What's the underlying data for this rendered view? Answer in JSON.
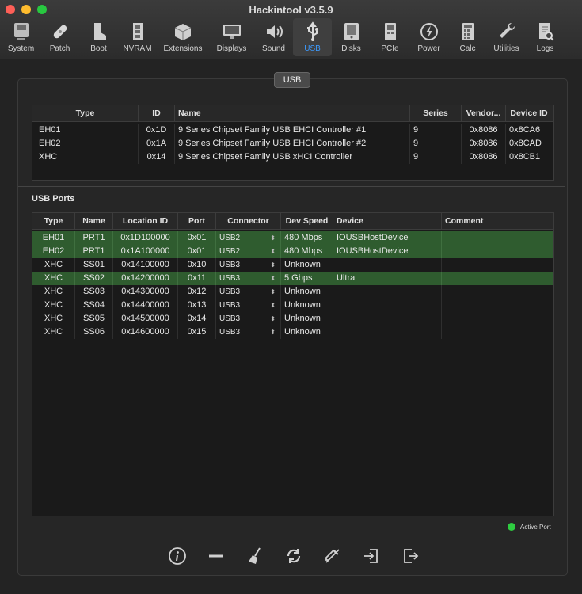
{
  "window": {
    "title": "Hackintool v3.5.9"
  },
  "toolbar": [
    {
      "id": "system",
      "label": "System",
      "icon": "computer-icon"
    },
    {
      "id": "patch",
      "label": "Patch",
      "icon": "bandage-icon"
    },
    {
      "id": "boot",
      "label": "Boot",
      "icon": "boot-icon"
    },
    {
      "id": "nvram",
      "label": "NVRAM",
      "icon": "memory-chip-icon"
    },
    {
      "id": "extensions",
      "label": "Extensions",
      "icon": "package-icon"
    },
    {
      "id": "displays",
      "label": "Displays",
      "icon": "monitor-icon"
    },
    {
      "id": "sound",
      "label": "Sound",
      "icon": "speaker-icon"
    },
    {
      "id": "usb",
      "label": "USB",
      "icon": "usb-icon",
      "active": true
    },
    {
      "id": "disks",
      "label": "Disks",
      "icon": "disk-icon"
    },
    {
      "id": "pcie",
      "label": "PCIe",
      "icon": "pcie-card-icon"
    },
    {
      "id": "power",
      "label": "Power",
      "icon": "lightning-icon"
    },
    {
      "id": "calc",
      "label": "Calc",
      "icon": "calculator-icon"
    },
    {
      "id": "utilities",
      "label": "Utilities",
      "icon": "wrench-icon"
    },
    {
      "id": "logs",
      "label": "Logs",
      "icon": "log-document-icon"
    }
  ],
  "panel": {
    "tab_label": "USB"
  },
  "controllers": {
    "headers": [
      "Type",
      "ID",
      "Name",
      "Series",
      "Vendor...",
      "Device ID"
    ],
    "rows": [
      [
        "EH01",
        "0x1D",
        "9 Series Chipset Family USB EHCI Controller #1",
        "9",
        "0x8086",
        "0x8CA6"
      ],
      [
        "EH02",
        "0x1A",
        "9 Series Chipset Family USB EHCI Controller #2",
        "9",
        "0x8086",
        "0x8CAD"
      ],
      [
        "XHC",
        "0x14",
        "9 Series Chipset Family USB xHCI Controller",
        "9",
        "0x8086",
        "0x8CB1"
      ]
    ]
  },
  "ports": {
    "title": "USB Ports",
    "headers": [
      "Type",
      "Name",
      "Location ID",
      "Port",
      "Connector",
      "Dev Speed",
      "Device",
      "Comment"
    ],
    "rows": [
      {
        "active": true,
        "cells": [
          "EH01",
          "PRT1",
          "0x1D100000",
          "0x01",
          "USB2",
          "480 Mbps",
          "IOUSBHostDevice",
          ""
        ]
      },
      {
        "active": true,
        "cells": [
          "EH02",
          "PRT1",
          "0x1A100000",
          "0x01",
          "USB2",
          "480 Mbps",
          "IOUSBHostDevice",
          ""
        ]
      },
      {
        "active": false,
        "cells": [
          "XHC",
          "SS01",
          "0x14100000",
          "0x10",
          "USB3",
          "Unknown",
          "",
          ""
        ]
      },
      {
        "active": true,
        "cells": [
          "XHC",
          "SS02",
          "0x14200000",
          "0x11",
          "USB3",
          "5 Gbps",
          "Ultra",
          ""
        ]
      },
      {
        "active": false,
        "cells": [
          "XHC",
          "SS03",
          "0x14300000",
          "0x12",
          "USB3",
          "Unknown",
          "",
          ""
        ]
      },
      {
        "active": false,
        "cells": [
          "XHC",
          "SS04",
          "0x14400000",
          "0x13",
          "USB3",
          "Unknown",
          "",
          ""
        ]
      },
      {
        "active": false,
        "cells": [
          "XHC",
          "SS05",
          "0x14500000",
          "0x14",
          "USB3",
          "Unknown",
          "",
          ""
        ]
      },
      {
        "active": false,
        "cells": [
          "XHC",
          "SS06",
          "0x14600000",
          "0x15",
          "USB3",
          "Unknown",
          "",
          ""
        ]
      }
    ]
  },
  "legend": {
    "label": "Active Port",
    "color": "#2ecc40"
  },
  "colors": {
    "active_row": "#2f5c2f",
    "accent": "#3d9bff"
  },
  "actions": [
    {
      "id": "info",
      "icon": "info-icon"
    },
    {
      "id": "remove",
      "icon": "minus-icon"
    },
    {
      "id": "clear",
      "icon": "broom-icon"
    },
    {
      "id": "refresh",
      "icon": "refresh-icon"
    },
    {
      "id": "inject",
      "icon": "syringe-icon"
    },
    {
      "id": "import",
      "icon": "import-icon"
    },
    {
      "id": "export",
      "icon": "export-icon"
    }
  ]
}
